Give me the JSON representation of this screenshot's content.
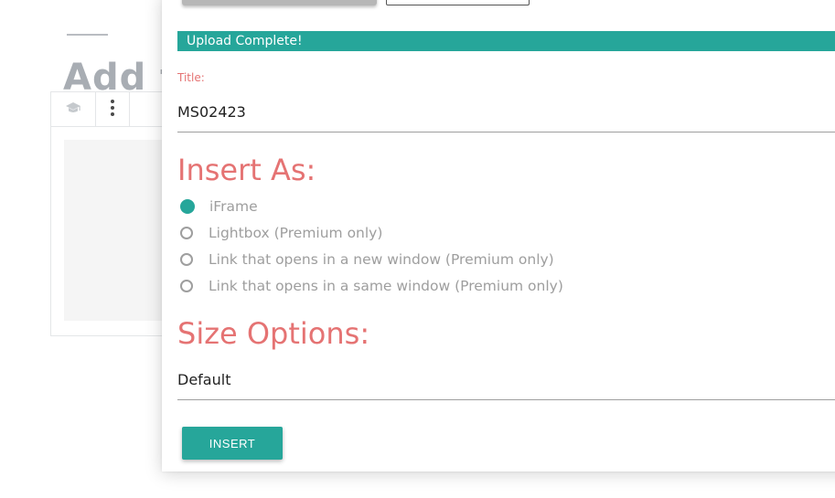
{
  "background": {
    "heading": "Add t",
    "toolbar_icons": [
      "graduation-cap-icon",
      "more-vertical-icon"
    ]
  },
  "modal": {
    "progress_text": "Upload Complete!",
    "title_label": "Title:",
    "title_value": "MS02423",
    "insert_as_heading": "Insert As:",
    "insert_options": [
      {
        "label": "iFrame",
        "checked": true
      },
      {
        "label": "Lightbox (Premium only)",
        "checked": false
      },
      {
        "label": "Link that opens in a new window (Premium only)",
        "checked": false
      },
      {
        "label": "Link that opens in a same window (Premium only)",
        "checked": false
      }
    ],
    "size_heading": "Size Options:",
    "size_value": "Default",
    "insert_button": "INSERT"
  },
  "colors": {
    "accent": "#26a69a",
    "heading": "#e57373",
    "muted": "#9e9e9e"
  }
}
